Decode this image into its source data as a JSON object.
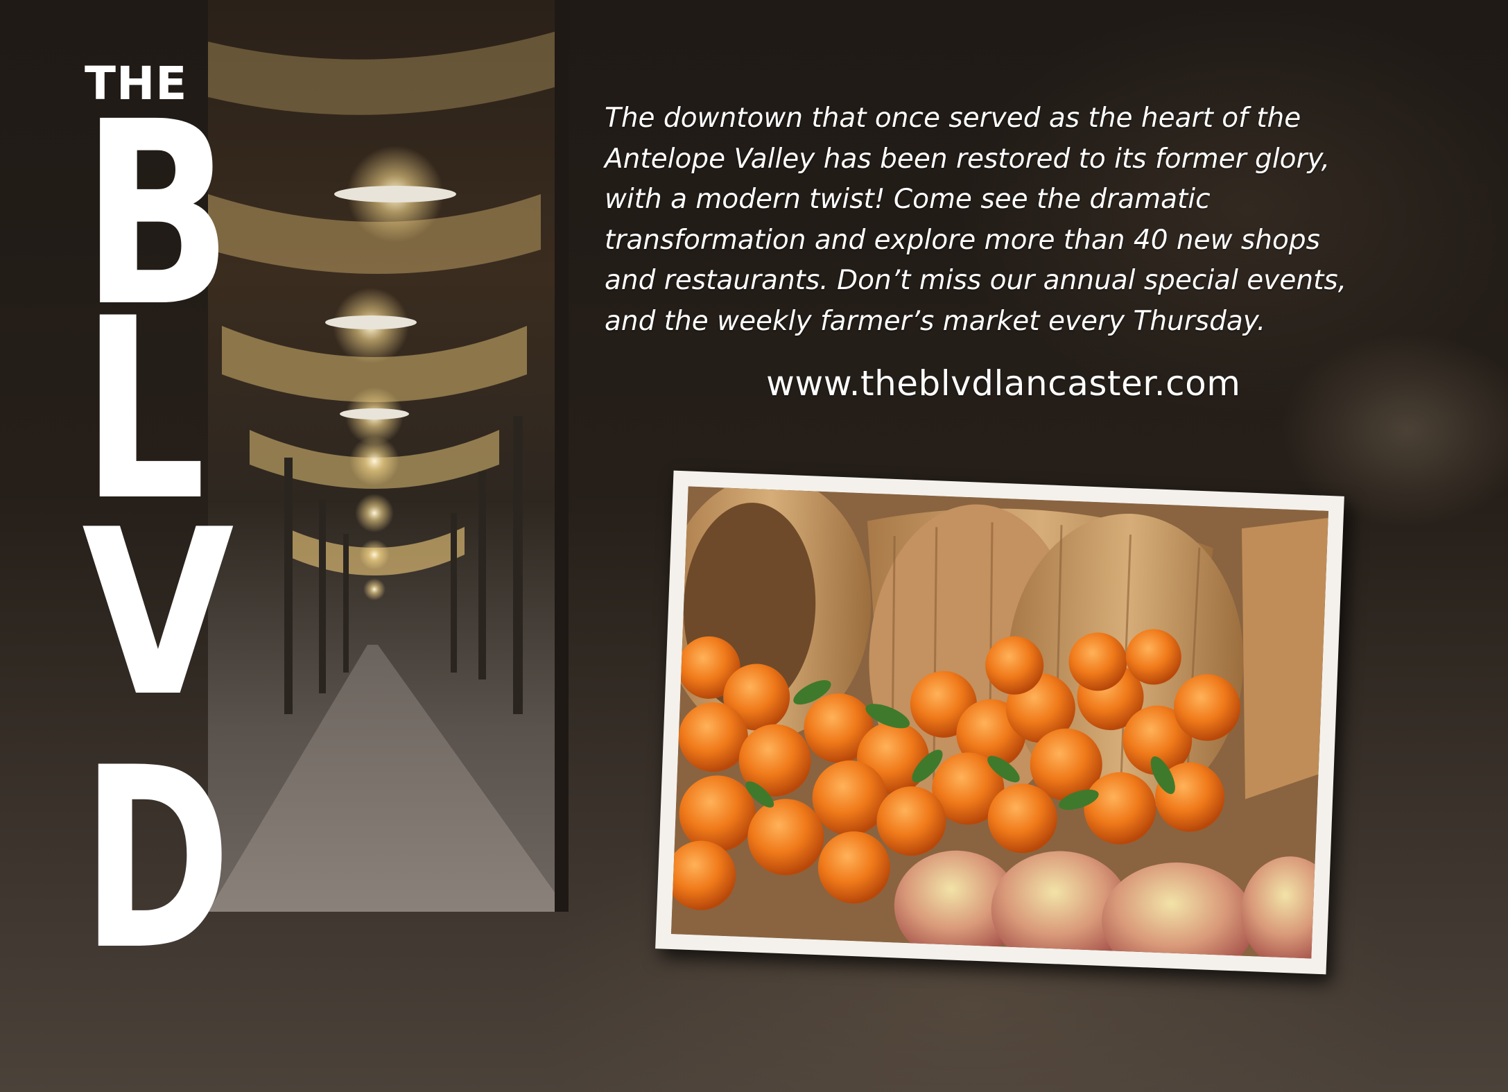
{
  "brand": {
    "the": "THE",
    "letters": [
      "B",
      "L",
      "V",
      "D"
    ]
  },
  "body": {
    "lines": [
      "The downtown that once served as the heart of the",
      "Antelope Valley has been restored to its former glory,",
      "with a modern twist! Come see the dramatic",
      "transformation and explore more than 40 new shops",
      "and restaurants. Don’t miss our annual special events,",
      "and the weekly farmer’s market every Thursday."
    ],
    "website": "www.theblvdlancaster.com"
  },
  "colors": {
    "text": "#ffffff",
    "frame": "#f4f1ec",
    "orange": "#f07a1a",
    "wood": "#c89a62"
  }
}
